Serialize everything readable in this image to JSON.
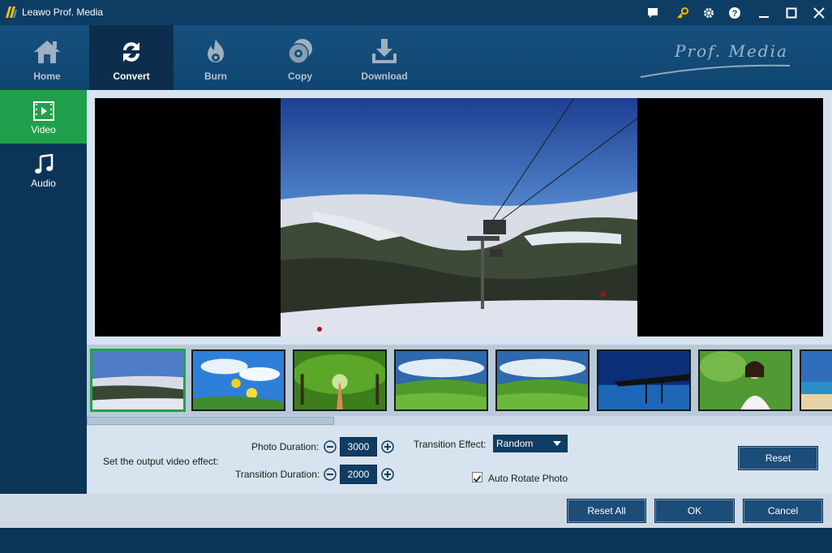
{
  "window": {
    "title": "Leawo Prof. Media",
    "controls": [
      "chat-icon",
      "key-icon",
      "gear-icon",
      "help-icon",
      "minimize-icon",
      "maximize-icon",
      "close-icon"
    ]
  },
  "topnav": {
    "items": [
      {
        "label": "Home",
        "icon": "home-icon",
        "active": false
      },
      {
        "label": "Convert",
        "icon": "convert-icon",
        "active": true
      },
      {
        "label": "Burn",
        "icon": "burn-icon",
        "active": false
      },
      {
        "label": "Copy",
        "icon": "copy-icon",
        "active": false
      },
      {
        "label": "Download",
        "icon": "download-icon",
        "active": false
      }
    ],
    "brand": "Prof. Media"
  },
  "sidenav": {
    "items": [
      {
        "label": "Video",
        "icon": "film-icon",
        "active": true
      },
      {
        "label": "Audio",
        "icon": "music-note-icon",
        "active": false
      }
    ]
  },
  "thumbnails": [
    {
      "scene": "ski-lift",
      "selected": true
    },
    {
      "scene": "flowers-sky",
      "selected": false
    },
    {
      "scene": "tree-path",
      "selected": false
    },
    {
      "scene": "green-hills",
      "selected": false
    },
    {
      "scene": "green-hills",
      "selected": false
    },
    {
      "scene": "pier-night",
      "selected": false
    },
    {
      "scene": "woman-portrait",
      "selected": false
    },
    {
      "scene": "beach",
      "selected": false
    }
  ],
  "settings": {
    "output_label": "Set the output video effect:",
    "photo_duration_label": "Photo Duration:",
    "photo_duration_value": "3000",
    "transition_duration_label": "Transition Duration:",
    "transition_duration_value": "2000",
    "transition_effect_label": "Transition Effect:",
    "transition_effect_value": "Random",
    "auto_rotate_label": "Auto Rotate Photo",
    "auto_rotate_checked": true,
    "reset_label": "Reset"
  },
  "footer": {
    "reset_all_label": "Reset All",
    "ok_label": "OK",
    "cancel_label": "Cancel"
  },
  "colors": {
    "accent_green": "#23a04d",
    "nav_dark": "#0b3556",
    "panel_light": "#d7e3ee"
  }
}
